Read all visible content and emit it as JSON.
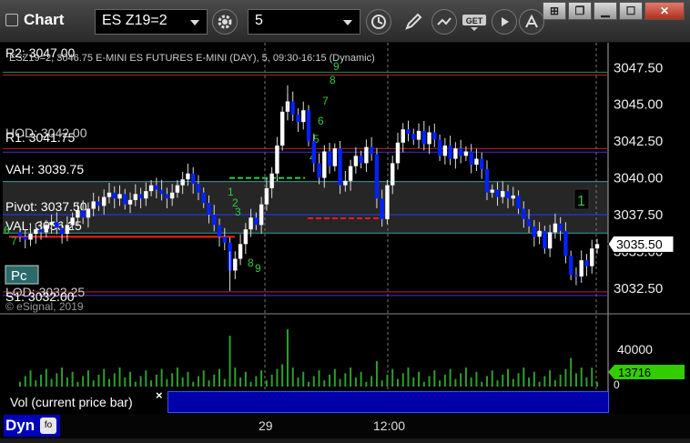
{
  "window": {
    "title": "Chart",
    "symbol": "ES Z19=2",
    "interval": "5"
  },
  "chart": {
    "header": "ESZ19=2, 3046.75 E-MINI ES FUTURES E-MINI (DAY), 5, 09:30-16:15 (Dynamic)",
    "watermark": "© eSignal, 2019",
    "price_labels": [
      "3047.50",
      "3045.00",
      "3042.50",
      "3040.00",
      "3037.50",
      "3035.00",
      "3032.50"
    ],
    "current_price": "3035.50",
    "level_labels": {
      "r2": "R2: 3047.00",
      "r1": "R1: 3041.75",
      "hod": "HOD: 3042.00",
      "vah": "VAH: 3039.75",
      "pivot": "Pivot: 3037.50",
      "val": "VAL: 3036.25",
      "s1": "S1: 3032.00",
      "lod": "LOD: 3032.25"
    },
    "pc_badge": "Pc",
    "count_marker": "1",
    "time_labels": [
      "29",
      "12:00"
    ],
    "td_numbers": [
      "6",
      "7",
      "8",
      "9",
      "1",
      "2",
      "3",
      "4",
      "5",
      "6",
      "7",
      "8",
      "9"
    ]
  },
  "volume": {
    "label": "Vol (current price bar)",
    "close_symbol": "×",
    "scale_top": "40000",
    "scale_bottom": "0",
    "current": "13716"
  },
  "footer": {
    "mode": "Dyn"
  },
  "colors": {
    "up_candle": "#ffffff",
    "down_candle": "#0022ff",
    "r_level": "#b3282d",
    "pivot": "#1e3cff",
    "vah": "#32a0a0",
    "volume": "#2ca02c",
    "volume_badge": "#33cc00"
  },
  "chart_data": {
    "type": "candlestick",
    "ylim": [
      3031.5,
      3048.2
    ],
    "levels": {
      "R2": 3047.0,
      "HOD": 3042.0,
      "R1": 3041.75,
      "VAH": 3039.75,
      "Pivot": 3037.5,
      "VAL": 3036.25,
      "LOD": 3032.25,
      "S1": 3032.0
    },
    "closes": [
      3036.0,
      3035.8,
      3036.2,
      3036.5,
      3036.3,
      3036.8,
      3037.0,
      3036.6,
      3036.2,
      3036.8,
      3037.3,
      3037.8,
      3037.3,
      3037.9,
      3038.4,
      3038.1,
      3038.7,
      3039.0,
      3038.6,
      3038.9,
      3038.2,
      3038.5,
      3038.9,
      3038.6,
      3039.1,
      3039.5,
      3039.2,
      3038.9,
      3038.6,
      3039.0,
      3039.5,
      3039.9,
      3040.3,
      3039.6,
      3039.0,
      3038.3,
      3037.5,
      3036.8,
      3036.0,
      3035.6,
      3033.7,
      3034.5,
      3035.5,
      3036.5,
      3037.3,
      3036.8,
      3038.2,
      3039.3,
      3040.3,
      3042.2,
      3044.5,
      3045.2,
      3044.3,
      3043.8,
      3044.6,
      3042.5,
      3041.0,
      3040.0,
      3041.8,
      3040.8,
      3042.0,
      3039.5,
      3039.8,
      3040.8,
      3041.5,
      3041.0,
      3042.1,
      3041.6,
      3038.6,
      3037.2,
      3039.5,
      3041.0,
      3042.4,
      3043.3,
      3043.0,
      3042.6,
      3043.2,
      3042.3,
      3043.1,
      3042.6,
      3041.5,
      3042.2,
      3041.3,
      3042.0,
      3041.5,
      3041.8,
      3040.9,
      3041.3,
      3040.6,
      3039.0,
      3039.2,
      3038.7,
      3039.1,
      3038.6,
      3038.8,
      3037.9,
      3037.2,
      3036.7,
      3036.0,
      3036.4,
      3035.2,
      3036.3,
      3036.9,
      3036.4,
      3034.7,
      3033.4,
      3033.3,
      3034.4,
      3034.0,
      3035.2,
      3035.5
    ],
    "volume_max": 40000,
    "volume_current": 13716
  }
}
